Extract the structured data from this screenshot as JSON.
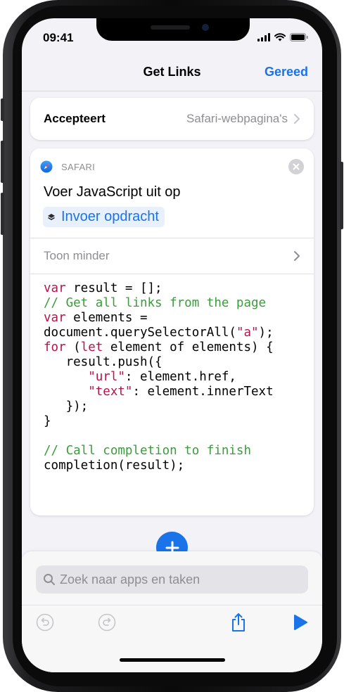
{
  "status": {
    "time": "09:41"
  },
  "nav": {
    "title": "Get Links",
    "done_label": "Gereed"
  },
  "accept": {
    "label": "Accepteert",
    "value": "Safari-webpagina's"
  },
  "action": {
    "app_label": "SAFARI",
    "title": "Voer JavaScript uit op",
    "token_label": "Invoer opdracht",
    "show_less_label": "Toon minder"
  },
  "code": {
    "lines": [
      [
        {
          "t": "var",
          "c": "kw"
        },
        {
          "t": " result = [];"
        }
      ],
      [
        {
          "t": "// Get all links from the page",
          "c": "cm"
        }
      ],
      [
        {
          "t": "var",
          "c": "kw"
        },
        {
          "t": " elements ="
        }
      ],
      [
        {
          "t": "document.querySelectorAll("
        },
        {
          "t": "\"a\"",
          "c": "st"
        },
        {
          "t": ");"
        }
      ],
      [
        {
          "t": "for",
          "c": "kw"
        },
        {
          "t": " ("
        },
        {
          "t": "let",
          "c": "kw"
        },
        {
          "t": " element of elements) {"
        }
      ],
      [
        {
          "t": "   result.push({"
        }
      ],
      [
        {
          "t": "      "
        },
        {
          "t": "\"url\"",
          "c": "st"
        },
        {
          "t": ": element.href,"
        }
      ],
      [
        {
          "t": "      "
        },
        {
          "t": "\"text\"",
          "c": "st"
        },
        {
          "t": ": element.innerText"
        }
      ],
      [
        {
          "t": "   });"
        }
      ],
      [
        {
          "t": "}"
        }
      ],
      [
        {
          "t": ""
        }
      ],
      [
        {
          "t": "// Call completion to finish",
          "c": "cm"
        }
      ],
      [
        {
          "t": "completion(result);"
        }
      ]
    ]
  },
  "search": {
    "placeholder": "Zoek naar apps en taken"
  },
  "icons": {
    "undo": "undo-icon",
    "redo": "redo-icon",
    "share": "share-icon",
    "play": "play-icon",
    "add": "plus-icon",
    "safari": "safari-compass-icon",
    "close": "close-icon"
  },
  "colors": {
    "accent": "#1a73e8",
    "keyword": "#b4154c",
    "comment": "#3c9b3c"
  }
}
